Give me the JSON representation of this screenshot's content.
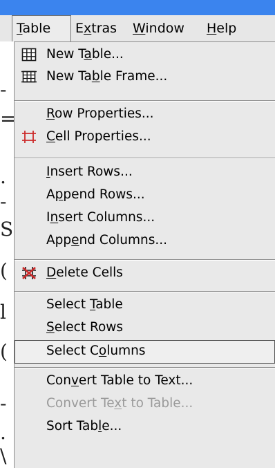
{
  "menubar": {
    "items": [
      {
        "label": "Table",
        "mnemonic": "T",
        "active": true
      },
      {
        "label": "Extras",
        "mnemonic": "x"
      },
      {
        "label": "Window",
        "mnemonic": "W"
      },
      {
        "label": "Help",
        "mnemonic": "H"
      }
    ]
  },
  "table_menu": {
    "items": [
      {
        "label": "New Table...",
        "mnemonic": "a",
        "icon": "table-grid-icon",
        "enabled": true
      },
      {
        "label": "New Table Frame...",
        "mnemonic": "b",
        "icon": "table-frame-icon",
        "enabled": true
      },
      {
        "label": "Row Properties...",
        "mnemonic": "R",
        "enabled": true
      },
      {
        "label": "Cell Properties...",
        "mnemonic": "C",
        "icon": "cell-properties-icon",
        "enabled": true
      },
      {
        "label": "Insert Rows...",
        "mnemonic": "I",
        "enabled": true
      },
      {
        "label": "Append Rows...",
        "mnemonic": "p",
        "enabled": true
      },
      {
        "label": "Insert Columns...",
        "mnemonic": "n",
        "enabled": true
      },
      {
        "label": "Append Columns...",
        "mnemonic": "e",
        "enabled": true
      },
      {
        "label": "Delete Cells",
        "mnemonic": "D",
        "icon": "delete-cells-icon",
        "enabled": true
      },
      {
        "label": "Select Table",
        "mnemonic": "T",
        "enabled": true
      },
      {
        "label": "Select Rows",
        "mnemonic": "S",
        "enabled": true
      },
      {
        "label": "Select Columns",
        "mnemonic": "o",
        "enabled": true,
        "highlighted": true
      },
      {
        "label": "Convert Table to Text...",
        "mnemonic": "v",
        "enabled": true
      },
      {
        "label": "Convert Text to Table...",
        "mnemonic": "x",
        "enabled": false
      },
      {
        "label": "Sort Table...",
        "mnemonic": "l",
        "enabled": true
      }
    ]
  },
  "colors": {
    "title_strip": "#3b84ee",
    "menu_background": "#e9e9e9",
    "icon_red": "#cc2a2a",
    "icon_dark": "#1a1a1a",
    "disabled_text": "#9a9a9a"
  },
  "background_fragments": [
    "-",
    "=",
    ".",
    "-",
    "S",
    "(",
    "l",
    "(",
    "-",
    ".",
    "\\"
  ]
}
